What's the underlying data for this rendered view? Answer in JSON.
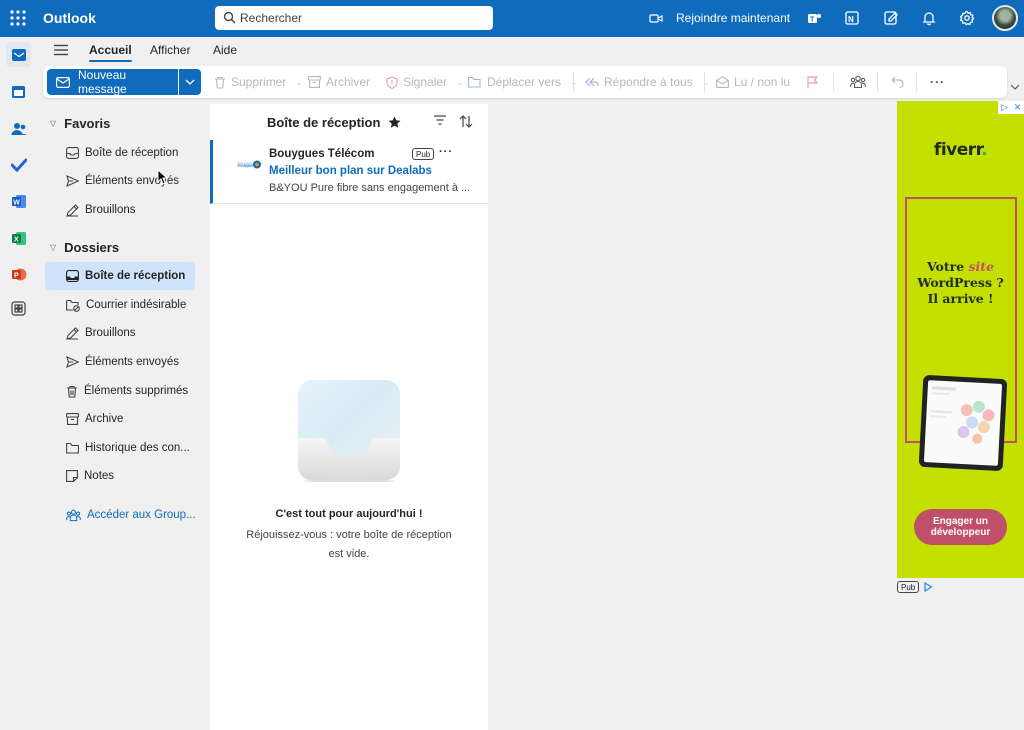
{
  "app": {
    "title": "Outlook"
  },
  "search": {
    "placeholder": "Rechercher"
  },
  "topbar": {
    "join_label": "Rejoindre maintenant",
    "icons": [
      "video-icon",
      "teams-icon",
      "onenote-icon",
      "whiteboard-icon",
      "bell-icon",
      "gear-icon"
    ]
  },
  "ribbon": {
    "tabs": [
      {
        "label": "Accueil",
        "active": true
      },
      {
        "label": "Afficher"
      },
      {
        "label": "Aide"
      }
    ],
    "new_message": "Nouveau message",
    "buttons": {
      "delete": "Supprimer",
      "archive": "Archiver",
      "report": "Signaler",
      "move": "Déplacer vers",
      "reply_all": "Répondre à tous",
      "read_unread": "Lu / non lu"
    }
  },
  "folders": {
    "favorites_header": "Favoris",
    "favorites": [
      {
        "label": "Boîte de réception",
        "icon": "inbox-icon"
      },
      {
        "label": "Éléments envoyés",
        "icon": "send-icon"
      },
      {
        "label": "Brouillons",
        "icon": "draft-icon"
      }
    ],
    "folders_header": "Dossiers",
    "items": [
      {
        "label": "Boîte de réception",
        "icon": "inbox-icon",
        "selected": true
      },
      {
        "label": "Courrier indésirable",
        "icon": "junk-icon"
      },
      {
        "label": "Brouillons",
        "icon": "draft-icon"
      },
      {
        "label": "Éléments envoyés",
        "icon": "send-icon"
      },
      {
        "label": "Éléments supprimés",
        "icon": "trash-icon"
      },
      {
        "label": "Archive",
        "icon": "archive-icon"
      },
      {
        "label": "Historique des con...",
        "icon": "folder-icon"
      },
      {
        "label": "Notes",
        "icon": "note-icon"
      }
    ],
    "groups_link": "Accéder aux Group..."
  },
  "message_list": {
    "title": "Boîte de réception",
    "messages": [
      {
        "sender": "Bouygues Télécom",
        "badge": "Pub",
        "subject": "Meilleur bon plan sur Dealabs",
        "preview": "B&YOU Pure fibre sans engagement à ..."
      }
    ],
    "empty_title": "C'est tout pour aujourd'hui !",
    "empty_text": "Réjouissez-vous : votre boîte de réception est vide."
  },
  "ad": {
    "brand": "fiverr",
    "brand_dot": ".",
    "headline_pre": "Votre ",
    "headline_highlight": "site",
    "headline_post": "WordPress ? Il arrive !",
    "cta": "Engager un développeur",
    "badge": "Pub"
  },
  "colors": {
    "accent": "#0f6cbd",
    "selected": "#cfe4fa",
    "ad_bg": "#c4e000",
    "ad_accent": "#c0506a"
  }
}
